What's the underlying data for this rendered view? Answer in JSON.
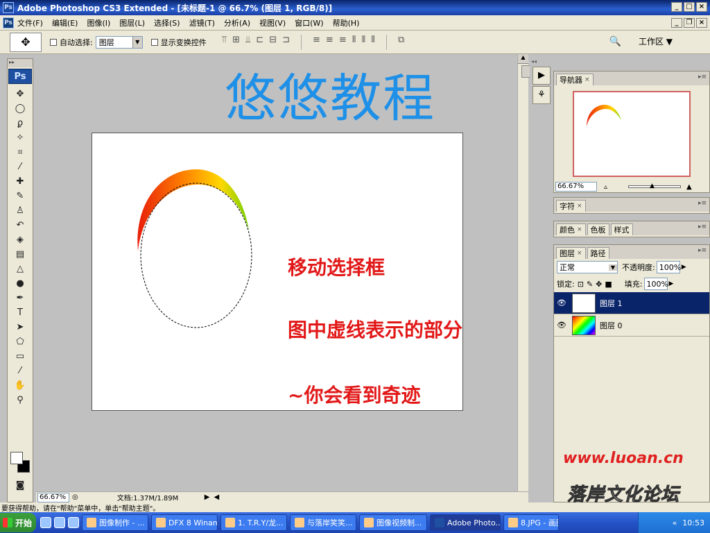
{
  "window": {
    "title": "Adobe Photoshop CS3 Extended - [未标题-1 @ 66.7% (图层 1, RGB/8)]"
  },
  "menu": [
    "文件(F)",
    "编辑(E)",
    "图像(I)",
    "图层(L)",
    "选择(S)",
    "滤镜(T)",
    "分析(A)",
    "视图(V)",
    "窗口(W)",
    "帮助(H)"
  ],
  "options": {
    "auto_select_label": "自动选择:",
    "auto_select_value": "图层",
    "show_transform_label": "显示变换控件",
    "workspace_label": "工作区 ▼"
  },
  "toolbox": {
    "logo": "Ps"
  },
  "canvas": {
    "headline": "悠悠教程",
    "notes": [
      "移动选择框",
      "图中虚线表示的部分",
      "~你会看到奇迹"
    ]
  },
  "status": {
    "zoom": "66.67%",
    "doc_info": "文档:1.37M/1.89M"
  },
  "hint": "要获得帮助，请在\"帮助\"菜单中，单击\"帮助主题\"。",
  "panels": {
    "navigator": {
      "tab": "导航器",
      "zoom": "66.67%"
    },
    "character": {
      "tab": "字符"
    },
    "color_tabs": [
      "颜色",
      "色板",
      "样式"
    ],
    "layers": {
      "tabs": [
        "图层",
        "路径"
      ],
      "blend_mode": "正常",
      "opacity_label": "不透明度:",
      "opacity_value": "100%",
      "lock_label": "锁定:",
      "fill_label": "填充:",
      "fill_value": "100%",
      "items": [
        "图层 1",
        "图层 0"
      ]
    }
  },
  "watermark": {
    "url": "www.luoan.cn",
    "text": "落岸文化论坛",
    "url2": "www.luoan.cn"
  },
  "taskbar": {
    "start": "开始",
    "tasks": [
      "图像制作 - ...",
      "DFX 8 Winamp",
      "1. T.R.Y/龙...",
      "与落岸笑笑...",
      "图像视频制...",
      "Adobe Photo...",
      "8.JPG - 画图"
    ],
    "clock": "10:53"
  }
}
